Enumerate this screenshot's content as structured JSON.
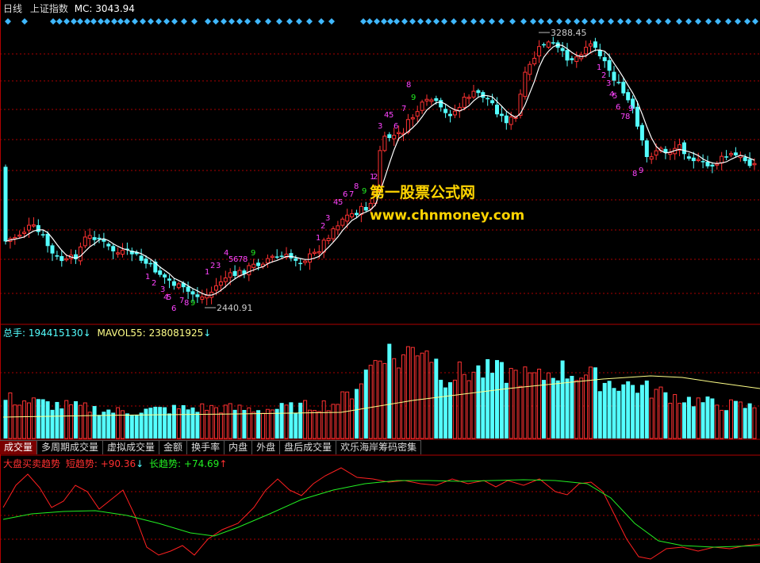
{
  "header": {
    "period": "日线",
    "index_name": "上证指数",
    "mc_label": "MC:",
    "mc_value": "3043.94"
  },
  "price_labels": {
    "high": "3288.45",
    "low": "2440.91"
  },
  "volume_header": {
    "total_label": "总手:",
    "total_value": "194415130",
    "total_arrow": "↓",
    "mavol_label": "MAVOL55:",
    "mavol_value": "238081925",
    "mavol_arrow": "↓"
  },
  "tabs": [
    "成交量",
    "多周期成交量",
    "虚拟成交量",
    "金额",
    "换手率",
    "内盘",
    "外盘",
    "盘后成交量",
    "欢乐海岸筹码密集"
  ],
  "indicator_header": {
    "name": "大盘买卖趋势",
    "short_label": "短趋势:",
    "short_value": "+90.36",
    "short_arrow": "↓",
    "long_label": "长趋势:",
    "long_value": "+74.69",
    "long_arrow": "↑"
  },
  "watermark": {
    "line1": "第一股票公式网",
    "line2": "www.chnmoney.com"
  },
  "colors": {
    "up": "#ff3232",
    "down": "#54ffff",
    "ma_line": "#ffffff",
    "mavol_line": "#ffff88",
    "short_trend": "#ff2020",
    "long_trend": "#22ee22",
    "diamond": "#3fb8ff",
    "count_magenta": "#ff44ff",
    "count_nine": "#22ee22",
    "grid_red": "#aa0000"
  },
  "chart_data": [
    {
      "type": "candlestick",
      "title": "上证指数 日线",
      "y_range_visible": [
        2440.91,
        3288.45
      ],
      "series": [
        {
          "name": "MC",
          "last": 3043.94
        }
      ],
      "annotations": {
        "high": 3288.45,
        "low": 2440.91
      },
      "td_count_sequences": [
        [
          "1",
          "2",
          "3",
          "4",
          "5",
          "6",
          "7",
          "8",
          "9"
        ],
        [
          "1",
          "2",
          "3",
          "4",
          "5",
          "6",
          "7",
          "8",
          "9"
        ],
        [
          "1",
          "2",
          "3",
          "4",
          "5",
          "6",
          "7",
          "8",
          "9"
        ],
        [
          "1",
          "2",
          "3",
          "4",
          "5",
          "6",
          "7",
          "8",
          "9"
        ],
        [
          "1",
          "2",
          "3",
          "4",
          "5",
          "6",
          "7",
          "8",
          "9"
        ],
        [
          "8",
          "9"
        ]
      ]
    },
    {
      "type": "bar",
      "title": "总手",
      "series": [
        {
          "name": "总手",
          "last": 194415130
        },
        {
          "name": "MAVOL55",
          "last": 238081925
        }
      ]
    },
    {
      "type": "line",
      "title": "大盘买卖趋势",
      "series": [
        {
          "name": "短趋势",
          "last": 90.36
        },
        {
          "name": "长趋势",
          "last": 74.69
        }
      ]
    }
  ]
}
